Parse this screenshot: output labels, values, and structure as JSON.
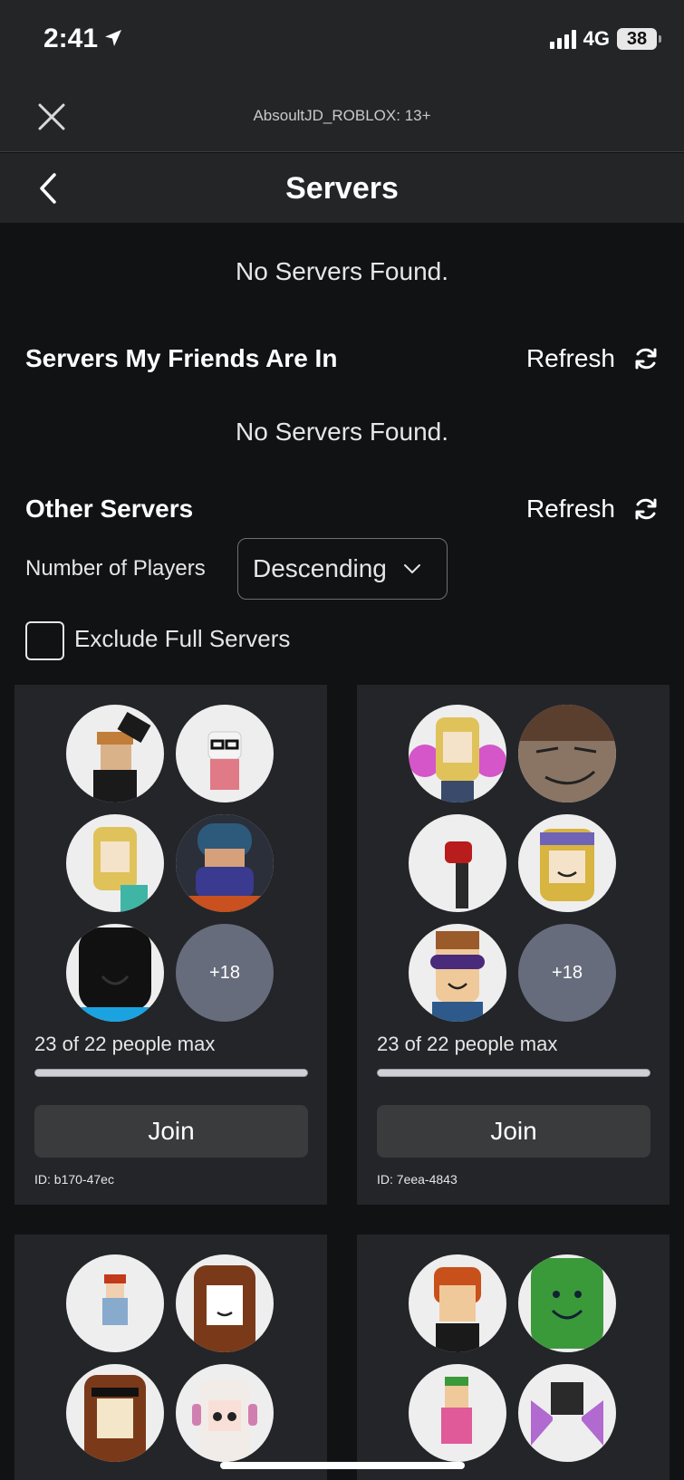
{
  "status_bar": {
    "time": "2:41",
    "network": "4G",
    "battery": "38"
  },
  "topbar": {
    "title": "AbsoultJD_ROBLOX: 13+"
  },
  "header": {
    "title": "Servers"
  },
  "sections": {
    "top_empty": "No Servers Found.",
    "friends_title": "Servers My Friends Are In",
    "friends_refresh": "Refresh",
    "friends_empty": "No Servers Found.",
    "other_title": "Other Servers",
    "other_refresh": "Refresh"
  },
  "filters": {
    "sort_label": "Number of Players",
    "sort_value": "Descending",
    "exclude_label": "Exclude Full Servers",
    "exclude_checked": false
  },
  "servers": [
    {
      "capacity": "23 of 22 people max",
      "fill": 1.0,
      "join": "Join",
      "id": "ID: b170-47ec",
      "more": "+18"
    },
    {
      "capacity": "23 of 22 people max",
      "fill": 1.0,
      "join": "Join",
      "id": "ID: 7eea-4843",
      "more": "+18"
    }
  ],
  "colors": {
    "accent_bar": "#232527",
    "card": "#232529",
    "more_badge": "#676c7c"
  }
}
